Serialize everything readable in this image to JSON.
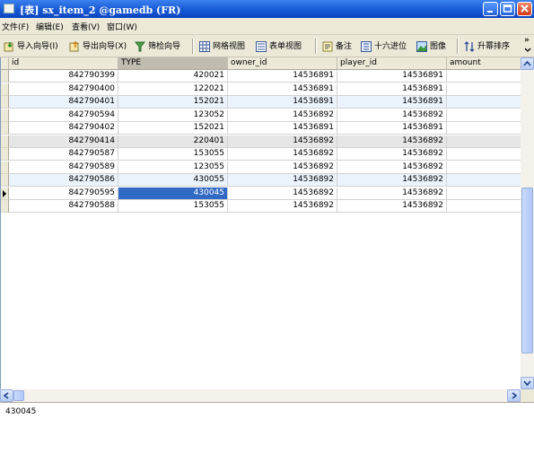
{
  "window": {
    "title": "[表] sx_item_2 @gamedb (FR)"
  },
  "menu": [
    {
      "label": "文件(F)"
    },
    {
      "label": "编辑(E)"
    },
    {
      "label": "查看(V)"
    },
    {
      "label": "窗口(W)"
    }
  ],
  "toolbar": {
    "import_wizard": "导入向导(I)",
    "export_wizard": "导出向导(X)",
    "filter_wizard": "筛检向导",
    "grid_view": "网格视图",
    "form_view": "表单视图",
    "memo": "备注",
    "hex": "十六进位",
    "image": "图像",
    "sort_asc": "升幂排序",
    "more": "»"
  },
  "table": {
    "columns": [
      "id",
      "TYPE",
      "owner_id",
      "player_id",
      "amount"
    ],
    "selected_column": "TYPE",
    "rows": [
      [
        "842790399",
        "420021",
        "14536891",
        "14536891",
        ""
      ],
      [
        "842790400",
        "122021",
        "14536891",
        "14536891",
        ""
      ],
      [
        "842790401",
        "152021",
        "14536891",
        "14536891",
        ""
      ],
      [
        "842790594",
        "123052",
        "14536892",
        "14536892",
        ""
      ],
      [
        "842790402",
        "152021",
        "14536891",
        "14536891",
        ""
      ],
      [
        "842790414",
        "220401",
        "14536892",
        "14536892",
        ""
      ],
      [
        "842790587",
        "153055",
        "14536892",
        "14536892",
        ""
      ],
      [
        "842790589",
        "123055",
        "14536892",
        "14536892",
        ""
      ],
      [
        "842790586",
        "430055",
        "14536892",
        "14536892",
        ""
      ],
      [
        "842790595",
        "430045",
        "14536892",
        "14536892",
        ""
      ],
      [
        "842790588",
        "153055",
        "14536892",
        "14536892",
        ""
      ]
    ],
    "current_row": 9,
    "current_column": 1,
    "row_colors": [
      "white",
      "white",
      "alt",
      "white",
      "white",
      "gray",
      "white",
      "white",
      "alt",
      "white",
      "white"
    ]
  },
  "detail_panel": {
    "value": "430045"
  }
}
